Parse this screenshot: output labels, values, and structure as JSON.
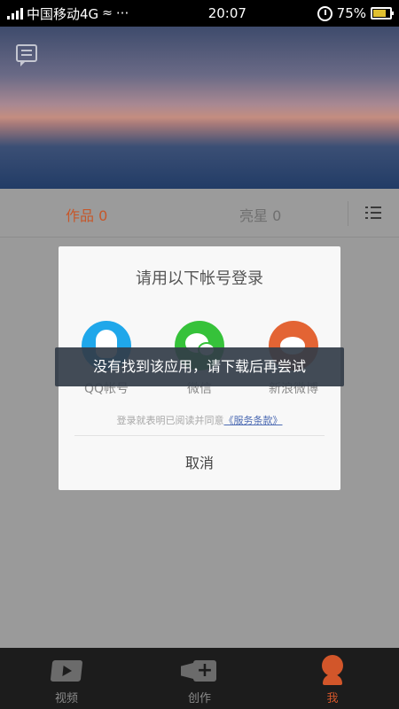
{
  "status_bar": {
    "carrier": "中国移动4G",
    "time": "20:07",
    "battery": "75%"
  },
  "tabs": {
    "works": "作品 0",
    "stars": "亮星 0"
  },
  "dialog": {
    "title": "请用以下帐号登录",
    "options": [
      {
        "label": "QQ帐号",
        "icon": "qq-icon"
      },
      {
        "label": "微信",
        "icon": "wechat-icon"
      },
      {
        "label": "新浪微博",
        "icon": "weibo-icon"
      }
    ],
    "agree_text": "登录就表明已阅读并同意",
    "agree_link": "《服务条款》",
    "cancel": "取消"
  },
  "toast": "没有找到该应用，请下载后再尝试",
  "bottom_nav": {
    "items": [
      {
        "label": "视频",
        "icon": "video-icon"
      },
      {
        "label": "创作",
        "icon": "create-icon"
      },
      {
        "label": "我",
        "icon": "profile-icon"
      }
    ]
  },
  "colors": {
    "accent": "#d2562a",
    "qq": "#1fa7ea",
    "wechat": "#36c23a",
    "weibo": "#e36434"
  }
}
